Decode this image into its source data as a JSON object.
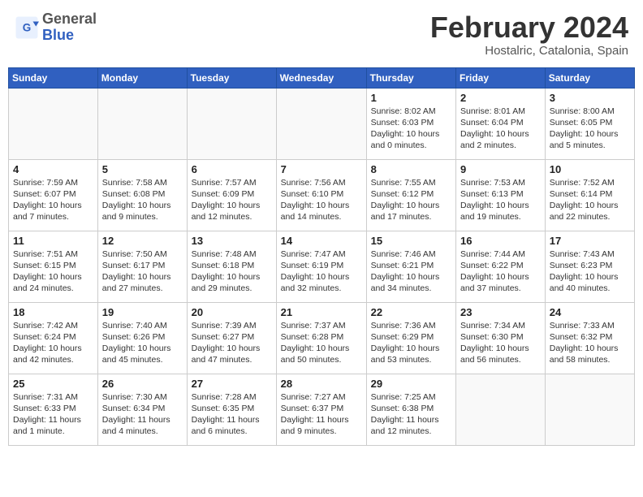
{
  "header": {
    "logo_general": "General",
    "logo_blue": "Blue",
    "title": "February 2024",
    "subtitle": "Hostalric, Catalonia, Spain"
  },
  "weekdays": [
    "Sunday",
    "Monday",
    "Tuesday",
    "Wednesday",
    "Thursday",
    "Friday",
    "Saturday"
  ],
  "weeks": [
    [
      {
        "day": "",
        "info": ""
      },
      {
        "day": "",
        "info": ""
      },
      {
        "day": "",
        "info": ""
      },
      {
        "day": "",
        "info": ""
      },
      {
        "day": "1",
        "info": "Sunrise: 8:02 AM\nSunset: 6:03 PM\nDaylight: 10 hours\nand 0 minutes."
      },
      {
        "day": "2",
        "info": "Sunrise: 8:01 AM\nSunset: 6:04 PM\nDaylight: 10 hours\nand 2 minutes."
      },
      {
        "day": "3",
        "info": "Sunrise: 8:00 AM\nSunset: 6:05 PM\nDaylight: 10 hours\nand 5 minutes."
      }
    ],
    [
      {
        "day": "4",
        "info": "Sunrise: 7:59 AM\nSunset: 6:07 PM\nDaylight: 10 hours\nand 7 minutes."
      },
      {
        "day": "5",
        "info": "Sunrise: 7:58 AM\nSunset: 6:08 PM\nDaylight: 10 hours\nand 9 minutes."
      },
      {
        "day": "6",
        "info": "Sunrise: 7:57 AM\nSunset: 6:09 PM\nDaylight: 10 hours\nand 12 minutes."
      },
      {
        "day": "7",
        "info": "Sunrise: 7:56 AM\nSunset: 6:10 PM\nDaylight: 10 hours\nand 14 minutes."
      },
      {
        "day": "8",
        "info": "Sunrise: 7:55 AM\nSunset: 6:12 PM\nDaylight: 10 hours\nand 17 minutes."
      },
      {
        "day": "9",
        "info": "Sunrise: 7:53 AM\nSunset: 6:13 PM\nDaylight: 10 hours\nand 19 minutes."
      },
      {
        "day": "10",
        "info": "Sunrise: 7:52 AM\nSunset: 6:14 PM\nDaylight: 10 hours\nand 22 minutes."
      }
    ],
    [
      {
        "day": "11",
        "info": "Sunrise: 7:51 AM\nSunset: 6:15 PM\nDaylight: 10 hours\nand 24 minutes."
      },
      {
        "day": "12",
        "info": "Sunrise: 7:50 AM\nSunset: 6:17 PM\nDaylight: 10 hours\nand 27 minutes."
      },
      {
        "day": "13",
        "info": "Sunrise: 7:48 AM\nSunset: 6:18 PM\nDaylight: 10 hours\nand 29 minutes."
      },
      {
        "day": "14",
        "info": "Sunrise: 7:47 AM\nSunset: 6:19 PM\nDaylight: 10 hours\nand 32 minutes."
      },
      {
        "day": "15",
        "info": "Sunrise: 7:46 AM\nSunset: 6:21 PM\nDaylight: 10 hours\nand 34 minutes."
      },
      {
        "day": "16",
        "info": "Sunrise: 7:44 AM\nSunset: 6:22 PM\nDaylight: 10 hours\nand 37 minutes."
      },
      {
        "day": "17",
        "info": "Sunrise: 7:43 AM\nSunset: 6:23 PM\nDaylight: 10 hours\nand 40 minutes."
      }
    ],
    [
      {
        "day": "18",
        "info": "Sunrise: 7:42 AM\nSunset: 6:24 PM\nDaylight: 10 hours\nand 42 minutes."
      },
      {
        "day": "19",
        "info": "Sunrise: 7:40 AM\nSunset: 6:26 PM\nDaylight: 10 hours\nand 45 minutes."
      },
      {
        "day": "20",
        "info": "Sunrise: 7:39 AM\nSunset: 6:27 PM\nDaylight: 10 hours\nand 47 minutes."
      },
      {
        "day": "21",
        "info": "Sunrise: 7:37 AM\nSunset: 6:28 PM\nDaylight: 10 hours\nand 50 minutes."
      },
      {
        "day": "22",
        "info": "Sunrise: 7:36 AM\nSunset: 6:29 PM\nDaylight: 10 hours\nand 53 minutes."
      },
      {
        "day": "23",
        "info": "Sunrise: 7:34 AM\nSunset: 6:30 PM\nDaylight: 10 hours\nand 56 minutes."
      },
      {
        "day": "24",
        "info": "Sunrise: 7:33 AM\nSunset: 6:32 PM\nDaylight: 10 hours\nand 58 minutes."
      }
    ],
    [
      {
        "day": "25",
        "info": "Sunrise: 7:31 AM\nSunset: 6:33 PM\nDaylight: 11 hours\nand 1 minute."
      },
      {
        "day": "26",
        "info": "Sunrise: 7:30 AM\nSunset: 6:34 PM\nDaylight: 11 hours\nand 4 minutes."
      },
      {
        "day": "27",
        "info": "Sunrise: 7:28 AM\nSunset: 6:35 PM\nDaylight: 11 hours\nand 6 minutes."
      },
      {
        "day": "28",
        "info": "Sunrise: 7:27 AM\nSunset: 6:37 PM\nDaylight: 11 hours\nand 9 minutes."
      },
      {
        "day": "29",
        "info": "Sunrise: 7:25 AM\nSunset: 6:38 PM\nDaylight: 11 hours\nand 12 minutes."
      },
      {
        "day": "",
        "info": ""
      },
      {
        "day": "",
        "info": ""
      }
    ]
  ]
}
